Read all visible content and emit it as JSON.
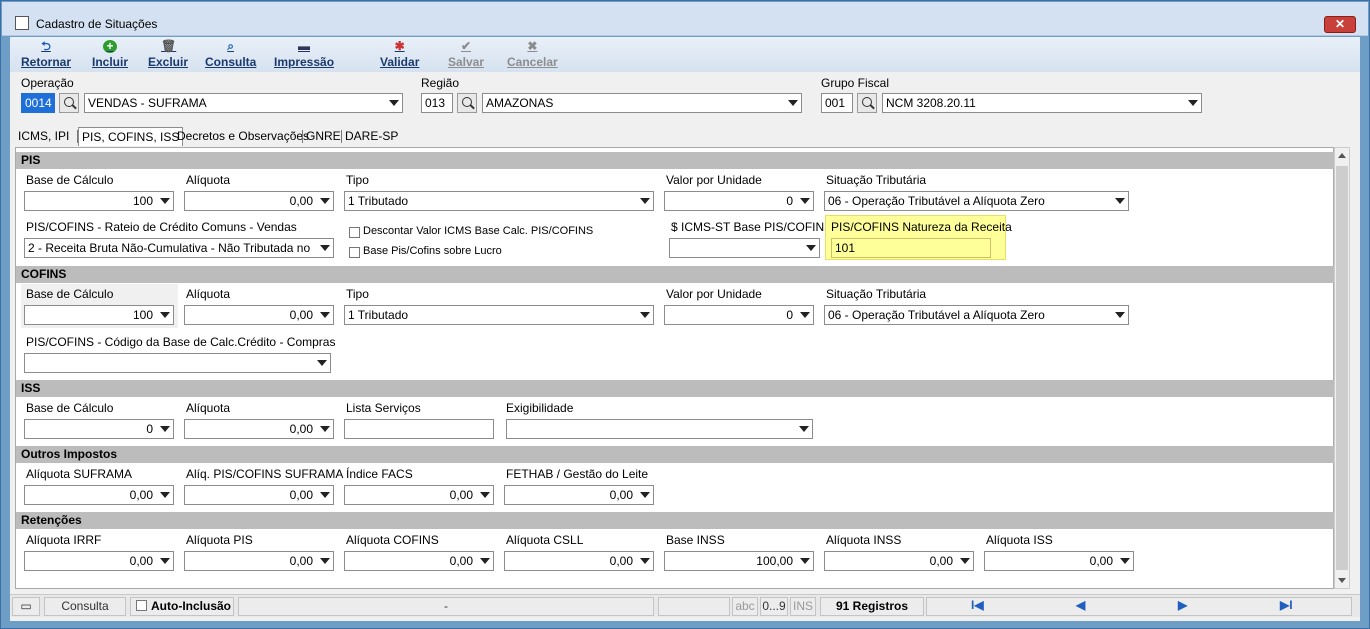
{
  "window": {
    "title": "Cadastro de Situações",
    "close_label": "✕"
  },
  "toolbar": {
    "retornar": "Retornar",
    "incluir": "Incluir",
    "excluir": "Excluir",
    "consulta": "Consulta",
    "impressao": "Impressão",
    "validar": "Validar",
    "salvar": "Salvar",
    "cancelar": "Cancelar"
  },
  "header": {
    "operacao_label": "Operação",
    "operacao_code": "0014",
    "operacao_name": "VENDAS  - SUFRAMA",
    "regiao_label": "Região",
    "regiao_code": "013",
    "regiao_name": "AMAZONAS",
    "grupo_label": "Grupo Fiscal",
    "grupo_code": "001",
    "grupo_name": "NCM 3208.20.11"
  },
  "tabs": [
    "ICMS, IPI",
    "PIS, COFINS, ISS",
    "Decretos e Observações",
    "GNRE",
    "DARE-SP"
  ],
  "pis": {
    "section": "PIS",
    "base_label": "Base de Cálculo",
    "base_value": "100",
    "aliquota_label": "Alíquota",
    "aliquota_value": "0,00",
    "tipo_label": "Tipo",
    "tipo_value": "1 Tributado",
    "valor_unidade_label": "Valor por Unidade",
    "valor_unidade_value": "0",
    "situacao_label": "Situação Tributária",
    "situacao_value": "06 - Operação Tributável a Alíquota Zero",
    "rateio_label": "PIS/COFINS - Rateio de Crédito Comuns - Vendas",
    "rateio_value": "2 - Receita Bruta Não-Cumulativa - Não Tributada no",
    "descontar_label": "Descontar Valor ICMS Base Calc. PIS/COFINS",
    "base_lucro_label": "Base Pis/Cofins sobre Lucro",
    "icms_st_label": "$ ICMS-ST Base PIS/COFINS",
    "icms_st_value": "",
    "natureza_label": "PIS/COFINS Natureza da Receita",
    "natureza_value": "101"
  },
  "cofins": {
    "section": "COFINS",
    "base_label": "Base de Cálculo",
    "base_value": "100",
    "aliquota_label": "Alíquota",
    "aliquota_value": "0,00",
    "tipo_label": "Tipo",
    "tipo_value": "1 Tributado",
    "valor_unidade_label": "Valor por Unidade",
    "valor_unidade_value": "0",
    "situacao_label": "Situação Tributária",
    "situacao_value": "06 - Operação Tributável a Alíquota Zero",
    "codigo_base_label": "PIS/COFINS - Código da Base de Calc.Crédito - Compras",
    "codigo_base_value": ""
  },
  "iss": {
    "section": "ISS",
    "base_label": "Base de Cálculo",
    "base_value": "0",
    "aliquota_label": "Alíquota",
    "aliquota_value": "0,00",
    "lista_label": "Lista Serviços",
    "lista_value": "",
    "exig_label": "Exigibilidade",
    "exig_value": ""
  },
  "outros": {
    "section": "Outros Impostos",
    "suframa_label": "Alíquota SUFRAMA",
    "suframa_value": "0,00",
    "pis_cofins_suframa_label": "Alíq. PIS/COFINS SUFRAMA",
    "pis_cofins_suframa_value": "0,00",
    "facs_label": "Índice FACS",
    "facs_value": "0,00",
    "fethab_label": "FETHAB / Gestão do Leite",
    "fethab_value": "0,00"
  },
  "retencoes": {
    "section": "Retenções",
    "irrf_label": "Alíquota IRRF",
    "irrf_value": "0,00",
    "pis_label": "Alíquota PIS",
    "pis_value": "0,00",
    "cofins_label": "Alíquota COFINS",
    "cofins_value": "0,00",
    "csll_label": "Alíquota CSLL",
    "csll_value": "0,00",
    "base_inss_label": "Base INSS",
    "base_inss_value": "100,00",
    "inss_label": "Alíquota INSS",
    "inss_value": "0,00",
    "iss_label": "Alíquota ISS",
    "iss_value": "0,00"
  },
  "status": {
    "consulta": "Consulta",
    "auto_inclusao": "Auto-Inclusão",
    "dash": "-",
    "abc": "abc",
    "num": "0...9",
    "ins": "INS",
    "registros": "91 Registros"
  },
  "nav": {
    "first": "I◀",
    "prev": "◀",
    "next": "▶",
    "last": "▶I"
  },
  "colors": {
    "highlight": "#ffff99",
    "section": "#bcbcbc",
    "window_border": "#6e9ec6"
  }
}
